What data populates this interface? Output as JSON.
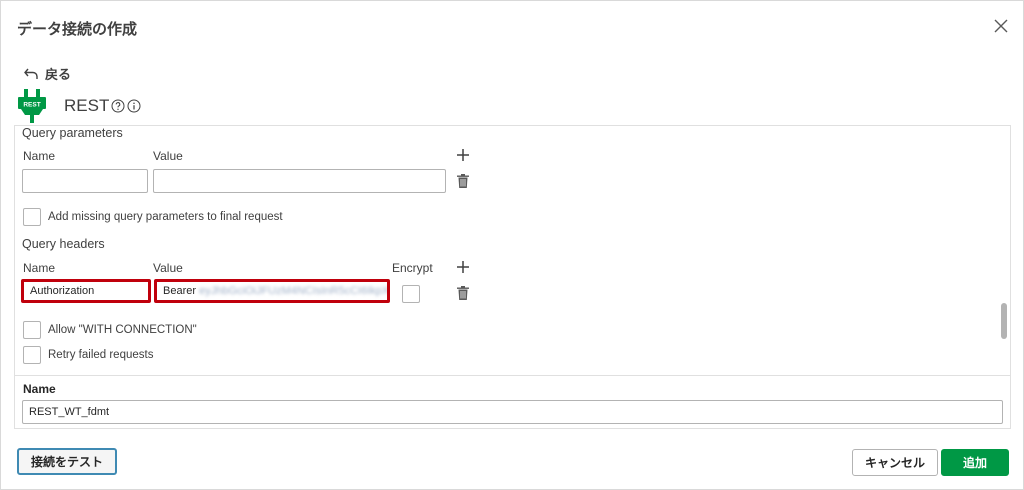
{
  "dialog": {
    "title": "データ接続の作成",
    "back_label": "戻る",
    "connector_name": "REST",
    "brand_color": "#009845",
    "highlight_color": "#c0000c"
  },
  "query_parameters": {
    "section_label": "Query parameters",
    "name_header": "Name",
    "value_header": "Value",
    "name_value": "",
    "value_value": "",
    "add_missing_label": "Add missing query parameters to final request"
  },
  "query_headers": {
    "section_label": "Query headers",
    "name_header": "Name",
    "value_header": "Value",
    "encrypt_header": "Encrypt",
    "row_name": "Authorization",
    "row_value_prefix": "Bearer",
    "row_value_redacted": "eyJhbGciOiJFUzM4NCIsInR5cCI6IkpXVCJ9"
  },
  "options": {
    "with_connection_label": "Allow \"WITH CONNECTION\"",
    "retry_label": "Retry failed requests"
  },
  "name_field": {
    "label": "Name",
    "value": "REST_WT_fdmt"
  },
  "footer": {
    "test_label": "接続をテスト",
    "cancel_label": "キャンセル",
    "add_label": "追加"
  },
  "icons": {
    "close": "close-icon",
    "back": "back-arrow-icon",
    "logo": "rest-plug-logo",
    "help": "help-icon",
    "info": "info-icon",
    "add": "plus-icon",
    "delete": "trash-icon"
  }
}
